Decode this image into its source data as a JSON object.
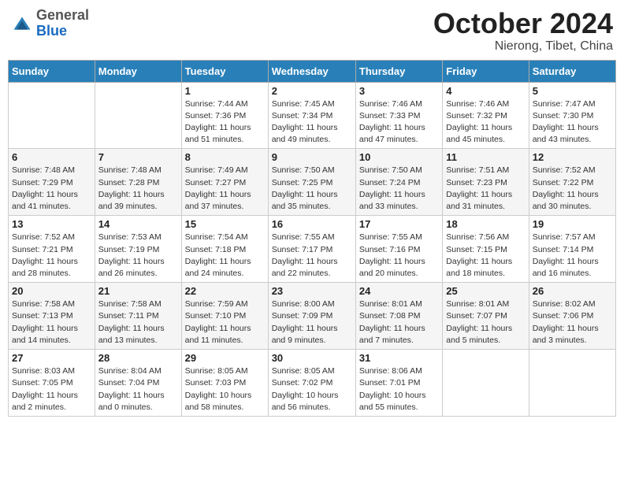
{
  "header": {
    "logo_general": "General",
    "logo_blue": "Blue",
    "month_title": "October 2024",
    "location": "Nierong, Tibet, China"
  },
  "weekdays": [
    "Sunday",
    "Monday",
    "Tuesday",
    "Wednesday",
    "Thursday",
    "Friday",
    "Saturday"
  ],
  "weeks": [
    [
      {
        "day": "",
        "info": ""
      },
      {
        "day": "",
        "info": ""
      },
      {
        "day": "1",
        "info": "Sunrise: 7:44 AM\nSunset: 7:36 PM\nDaylight: 11 hours and 51 minutes."
      },
      {
        "day": "2",
        "info": "Sunrise: 7:45 AM\nSunset: 7:34 PM\nDaylight: 11 hours and 49 minutes."
      },
      {
        "day": "3",
        "info": "Sunrise: 7:46 AM\nSunset: 7:33 PM\nDaylight: 11 hours and 47 minutes."
      },
      {
        "day": "4",
        "info": "Sunrise: 7:46 AM\nSunset: 7:32 PM\nDaylight: 11 hours and 45 minutes."
      },
      {
        "day": "5",
        "info": "Sunrise: 7:47 AM\nSunset: 7:30 PM\nDaylight: 11 hours and 43 minutes."
      }
    ],
    [
      {
        "day": "6",
        "info": "Sunrise: 7:48 AM\nSunset: 7:29 PM\nDaylight: 11 hours and 41 minutes."
      },
      {
        "day": "7",
        "info": "Sunrise: 7:48 AM\nSunset: 7:28 PM\nDaylight: 11 hours and 39 minutes."
      },
      {
        "day": "8",
        "info": "Sunrise: 7:49 AM\nSunset: 7:27 PM\nDaylight: 11 hours and 37 minutes."
      },
      {
        "day": "9",
        "info": "Sunrise: 7:50 AM\nSunset: 7:25 PM\nDaylight: 11 hours and 35 minutes."
      },
      {
        "day": "10",
        "info": "Sunrise: 7:50 AM\nSunset: 7:24 PM\nDaylight: 11 hours and 33 minutes."
      },
      {
        "day": "11",
        "info": "Sunrise: 7:51 AM\nSunset: 7:23 PM\nDaylight: 11 hours and 31 minutes."
      },
      {
        "day": "12",
        "info": "Sunrise: 7:52 AM\nSunset: 7:22 PM\nDaylight: 11 hours and 30 minutes."
      }
    ],
    [
      {
        "day": "13",
        "info": "Sunrise: 7:52 AM\nSunset: 7:21 PM\nDaylight: 11 hours and 28 minutes."
      },
      {
        "day": "14",
        "info": "Sunrise: 7:53 AM\nSunset: 7:19 PM\nDaylight: 11 hours and 26 minutes."
      },
      {
        "day": "15",
        "info": "Sunrise: 7:54 AM\nSunset: 7:18 PM\nDaylight: 11 hours and 24 minutes."
      },
      {
        "day": "16",
        "info": "Sunrise: 7:55 AM\nSunset: 7:17 PM\nDaylight: 11 hours and 22 minutes."
      },
      {
        "day": "17",
        "info": "Sunrise: 7:55 AM\nSunset: 7:16 PM\nDaylight: 11 hours and 20 minutes."
      },
      {
        "day": "18",
        "info": "Sunrise: 7:56 AM\nSunset: 7:15 PM\nDaylight: 11 hours and 18 minutes."
      },
      {
        "day": "19",
        "info": "Sunrise: 7:57 AM\nSunset: 7:14 PM\nDaylight: 11 hours and 16 minutes."
      }
    ],
    [
      {
        "day": "20",
        "info": "Sunrise: 7:58 AM\nSunset: 7:13 PM\nDaylight: 11 hours and 14 minutes."
      },
      {
        "day": "21",
        "info": "Sunrise: 7:58 AM\nSunset: 7:11 PM\nDaylight: 11 hours and 13 minutes."
      },
      {
        "day": "22",
        "info": "Sunrise: 7:59 AM\nSunset: 7:10 PM\nDaylight: 11 hours and 11 minutes."
      },
      {
        "day": "23",
        "info": "Sunrise: 8:00 AM\nSunset: 7:09 PM\nDaylight: 11 hours and 9 minutes."
      },
      {
        "day": "24",
        "info": "Sunrise: 8:01 AM\nSunset: 7:08 PM\nDaylight: 11 hours and 7 minutes."
      },
      {
        "day": "25",
        "info": "Sunrise: 8:01 AM\nSunset: 7:07 PM\nDaylight: 11 hours and 5 minutes."
      },
      {
        "day": "26",
        "info": "Sunrise: 8:02 AM\nSunset: 7:06 PM\nDaylight: 11 hours and 3 minutes."
      }
    ],
    [
      {
        "day": "27",
        "info": "Sunrise: 8:03 AM\nSunset: 7:05 PM\nDaylight: 11 hours and 2 minutes."
      },
      {
        "day": "28",
        "info": "Sunrise: 8:04 AM\nSunset: 7:04 PM\nDaylight: 11 hours and 0 minutes."
      },
      {
        "day": "29",
        "info": "Sunrise: 8:05 AM\nSunset: 7:03 PM\nDaylight: 10 hours and 58 minutes."
      },
      {
        "day": "30",
        "info": "Sunrise: 8:05 AM\nSunset: 7:02 PM\nDaylight: 10 hours and 56 minutes."
      },
      {
        "day": "31",
        "info": "Sunrise: 8:06 AM\nSunset: 7:01 PM\nDaylight: 10 hours and 55 minutes."
      },
      {
        "day": "",
        "info": ""
      },
      {
        "day": "",
        "info": ""
      }
    ]
  ]
}
